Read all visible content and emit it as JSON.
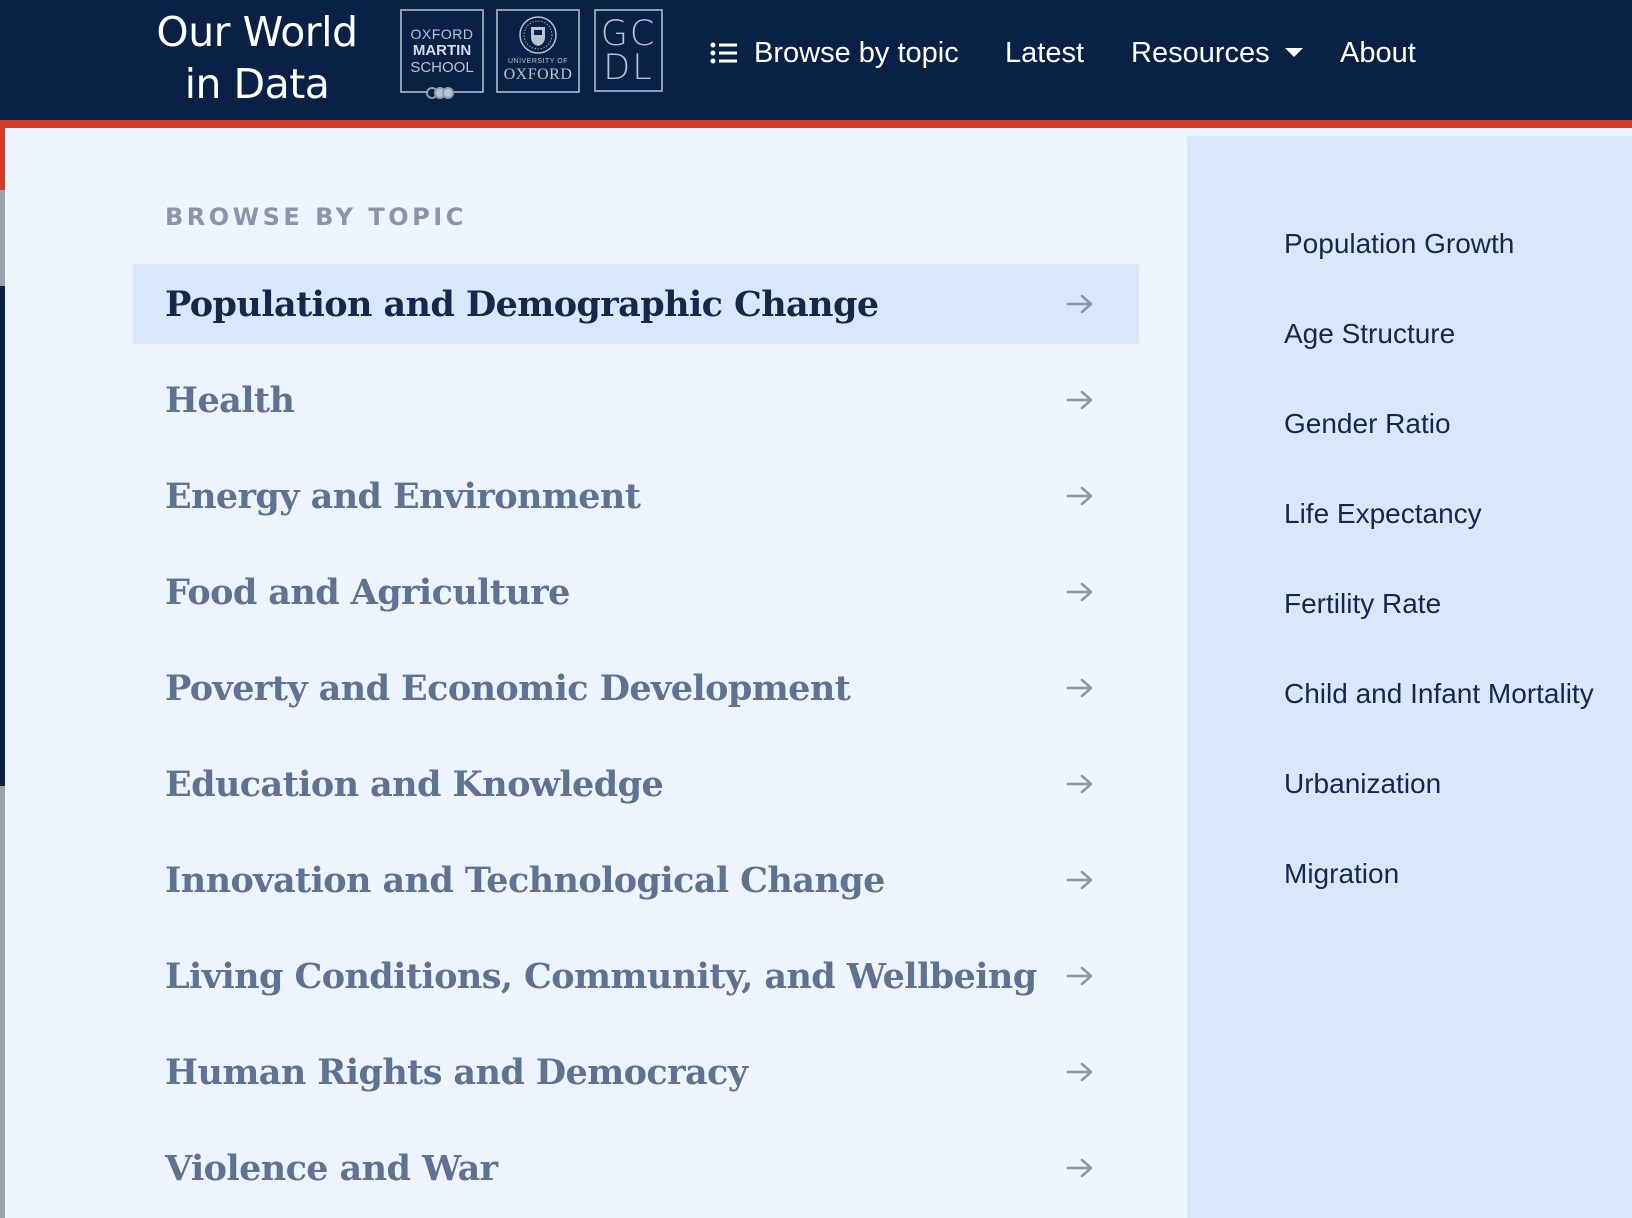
{
  "header": {
    "brand_line1": "Our World",
    "brand_line2": "in Data",
    "logos": {
      "oms_line1": "OXFORD",
      "oms_line2": "MARTIN",
      "oms_line3": "SCHOOL",
      "oxford_small": "UNIVERSITY OF",
      "oxford_big": "OXFORD",
      "gcdl_top": "GC",
      "gcdl_bottom": "DL"
    },
    "nav": {
      "browse_label": "Browse by topic",
      "latest_label": "Latest",
      "resources_label": "Resources",
      "about_label": "About"
    }
  },
  "menu": {
    "section_title": "BROWSE BY TOPIC",
    "topics": [
      {
        "label": "Population and Demographic Change",
        "active": true
      },
      {
        "label": "Health"
      },
      {
        "label": "Energy and Environment"
      },
      {
        "label": "Food and Agriculture"
      },
      {
        "label": "Poverty and Economic Development"
      },
      {
        "label": "Education and Knowledge"
      },
      {
        "label": "Innovation and Technological Change"
      },
      {
        "label": "Living Conditions, Community, and Wellbeing"
      },
      {
        "label": "Human Rights and Democracy"
      },
      {
        "label": "Violence and War"
      }
    ],
    "subtopics": [
      "Population Growth",
      "Age Structure",
      "Gender Ratio",
      "Life Expectancy",
      "Fertility Rate",
      "Child and Infant Mortality",
      "Urbanization",
      "Migration"
    ]
  },
  "icons": {
    "browse": "list-icon",
    "resources": "caret-down-icon",
    "topic_arrow": "arrow-right-icon"
  },
  "colors": {
    "header_bg": "#0a2146",
    "accent_red": "#ce3b28",
    "left_panel_bg": "#edf4fd",
    "right_panel_bg": "#dae7fb",
    "active_row_bg": "#d9e7fa",
    "active_text": "#14294a",
    "inactive_text": "#5e7291"
  }
}
